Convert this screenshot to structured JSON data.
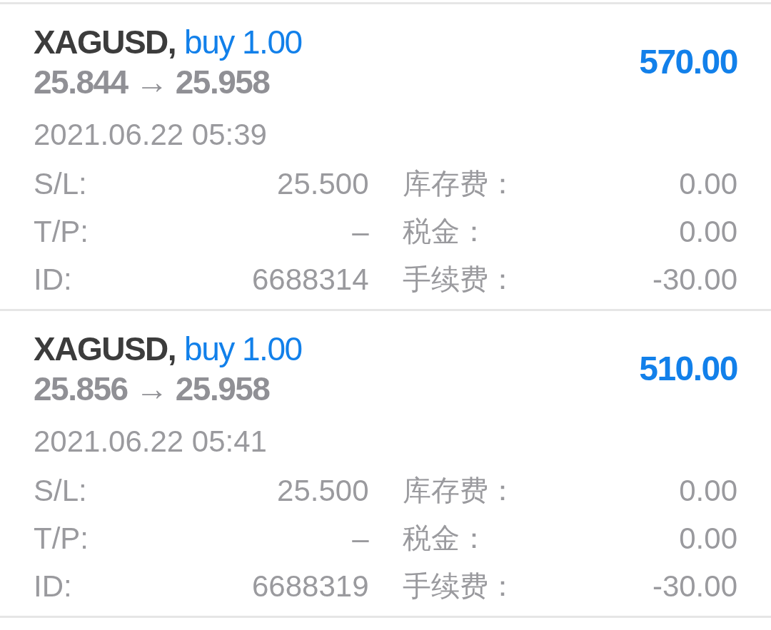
{
  "trades": [
    {
      "symbol": "XAGUSD,",
      "order": "buy 1.00",
      "prices": "25.844 → 25.958",
      "profit": "570.00",
      "time": "2021.06.22 05:39",
      "details": [
        {
          "label": "S/L:",
          "value": "25.500"
        },
        {
          "label": "T/P:",
          "value": "–"
        },
        {
          "label": "ID:",
          "value": "6688314"
        }
      ],
      "charges": [
        {
          "label": "库存费：",
          "value": "0.00"
        },
        {
          "label": "税金：",
          "value": "0.00"
        },
        {
          "label": "手续费：",
          "value": "-30.00"
        }
      ]
    },
    {
      "symbol": "XAGUSD,",
      "order": "buy 1.00",
      "prices": "25.856 → 25.958",
      "profit": "510.00",
      "time": "2021.06.22 05:41",
      "details": [
        {
          "label": "S/L:",
          "value": "25.500"
        },
        {
          "label": "T/P:",
          "value": "–"
        },
        {
          "label": "ID:",
          "value": "6688319"
        }
      ],
      "charges": [
        {
          "label": "库存费：",
          "value": "0.00"
        },
        {
          "label": "税金：",
          "value": "0.00"
        },
        {
          "label": "手续费：",
          "value": "-30.00"
        }
      ]
    }
  ]
}
